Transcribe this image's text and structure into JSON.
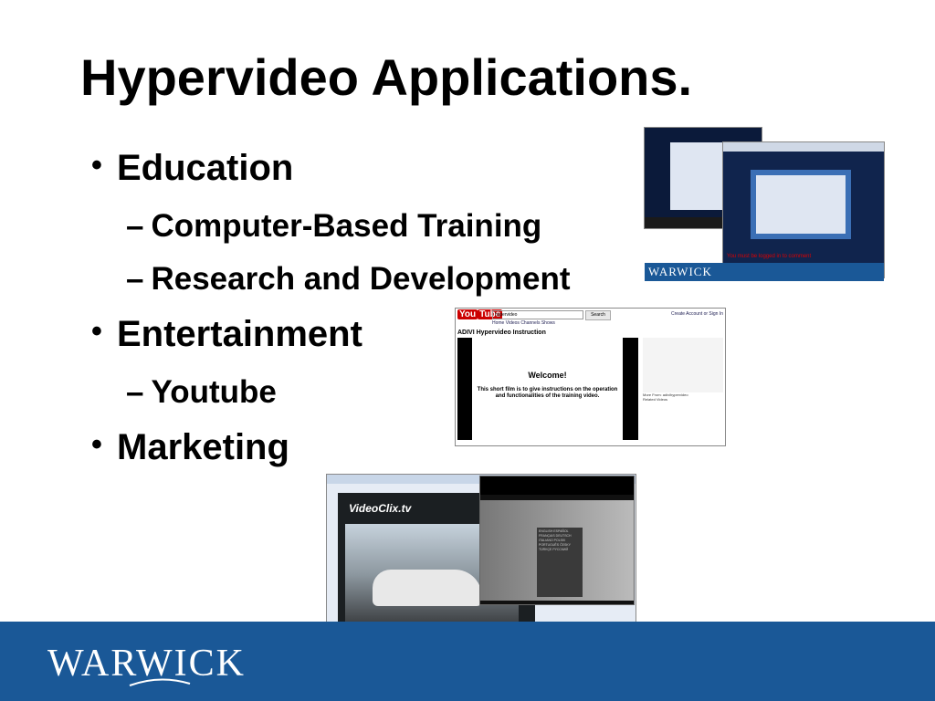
{
  "slide": {
    "title": "Hypervideo Applications.",
    "bullets": [
      {
        "text": "Education",
        "subs": [
          "Computer-Based Training",
          "Research and Development"
        ]
      },
      {
        "text": "Entertainment",
        "subs": [
          "Youtube"
        ]
      },
      {
        "text": "Marketing",
        "subs": []
      }
    ]
  },
  "footer": {
    "logo": "WARWICK",
    "color": "#1a5897"
  },
  "screens": {
    "warwick_player": {
      "band": "WARWICK",
      "message": "You must be logged in to comment"
    },
    "youtube": {
      "logo_a": "You",
      "logo_b": "Tube",
      "search_value": "hypervideo",
      "search_button": "Search",
      "nav": "Home  Videos  Channels  Shows",
      "account": "Create Account  or  Sign In",
      "video_title": "ADIVI Hypervideo Instruction",
      "welcome": "Welcome!",
      "description": "This short film is to give instructions on the operation and functionalities of the training video.",
      "side_text": "More From: adivihypervideo",
      "related": "Related Videos"
    },
    "videoclix": {
      "logo": "VideoClix.tv",
      "languages": "ENGLISH ESPAÑOL FRANÇAIS DEUTSCH ITALIANO POLSKI PORTUGUÊS ČESKY TÜRKÇE РУССКИЙ"
    }
  }
}
